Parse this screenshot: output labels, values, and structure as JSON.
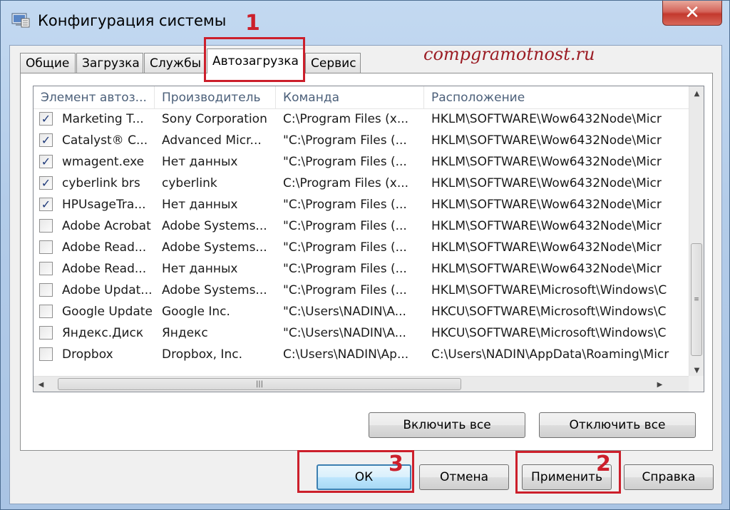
{
  "window": {
    "title": "Конфигурация системы",
    "close_glyph": "✕"
  },
  "tabs": [
    {
      "label": "Общие"
    },
    {
      "label": "Загрузка"
    },
    {
      "label": "Службы"
    },
    {
      "label": "Автозагрузка",
      "active": true
    },
    {
      "label": "Сервис"
    }
  ],
  "watermark": "compgramotnost.ru",
  "table": {
    "columns": [
      "Элемент автоз...",
      "Производитель",
      "Команда",
      "Расположение"
    ],
    "rows": [
      {
        "checked": true,
        "name": "Marketing T...",
        "maker": "Sony Corporation",
        "command": "C:\\Program Files (x...",
        "location": "HKLM\\SOFTWARE\\Wow6432Node\\Micr"
      },
      {
        "checked": true,
        "name": "Catalyst® C...",
        "maker": "Advanced Micr...",
        "command": "\"C:\\Program Files (...",
        "location": "HKLM\\SOFTWARE\\Wow6432Node\\Micr"
      },
      {
        "checked": true,
        "name": "wmagent.exe",
        "maker": "Нет данных",
        "command": "\"C:\\Program Files (...",
        "location": "HKLM\\SOFTWARE\\Wow6432Node\\Micr"
      },
      {
        "checked": true,
        "name": "cyberlink brs",
        "maker": "cyberlink",
        "command": "C:\\Program Files (x...",
        "location": "HKLM\\SOFTWARE\\Wow6432Node\\Micr"
      },
      {
        "checked": true,
        "name": "HPUsageTra...",
        "maker": "Нет данных",
        "command": "\"C:\\Program Files (...",
        "location": "HKLM\\SOFTWARE\\Wow6432Node\\Micr"
      },
      {
        "checked": false,
        "name": "Adobe Acrobat",
        "maker": "Adobe Systems...",
        "command": "\"C:\\Program Files (...",
        "location": "HKLM\\SOFTWARE\\Wow6432Node\\Micr"
      },
      {
        "checked": false,
        "name": "Adobe Read...",
        "maker": "Adobe Systems...",
        "command": "\"C:\\Program Files (...",
        "location": "HKLM\\SOFTWARE\\Wow6432Node\\Micr"
      },
      {
        "checked": false,
        "name": "Adobe Read...",
        "maker": "Нет данных",
        "command": "\"C:\\Program Files (...",
        "location": "HKLM\\SOFTWARE\\Wow6432Node\\Micr"
      },
      {
        "checked": false,
        "name": "Adobe Updat...",
        "maker": "Adobe Systems...",
        "command": "\"C:\\Program Files (...",
        "location": "HKLM\\SOFTWARE\\Microsoft\\Windows\\C"
      },
      {
        "checked": false,
        "name": "Google Update",
        "maker": "Google Inc.",
        "command": "\"C:\\Users\\NADIN\\A...",
        "location": "HKCU\\SOFTWARE\\Microsoft\\Windows\\C"
      },
      {
        "checked": false,
        "name": "Яндекс.Диск",
        "maker": "Яндекс",
        "command": "\"C:\\Users\\NADIN\\A...",
        "location": "HKCU\\SOFTWARE\\Microsoft\\Windows\\C"
      },
      {
        "checked": false,
        "name": "Dropbox",
        "maker": "Dropbox, Inc.",
        "command": "C:\\Users\\NADIN\\Ap...",
        "location": "C:\\Users\\NADIN\\AppData\\Roaming\\Micr"
      }
    ]
  },
  "buttons": {
    "enable_all": "Включить все",
    "disable_all": "Отключить все",
    "ok": "ОК",
    "cancel": "Отмена",
    "apply": "Применить",
    "help": "Справка"
  },
  "annotations": {
    "n1": "1",
    "n2": "2",
    "n3": "3",
    "color": "#cc1f2b"
  }
}
